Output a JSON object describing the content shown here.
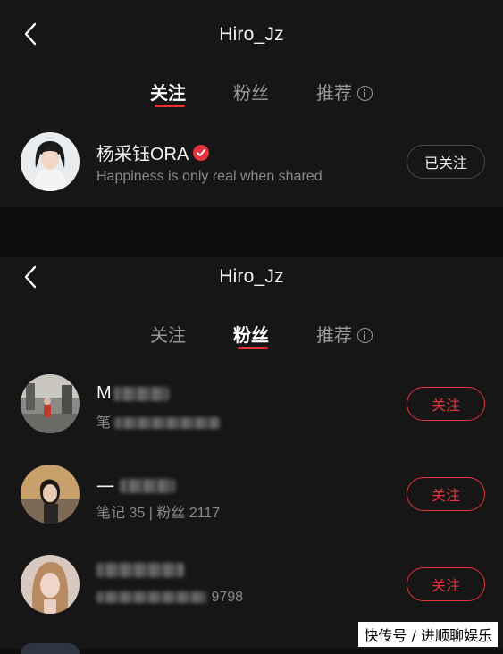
{
  "top": {
    "title": "Hiro_Jz",
    "tabs": [
      {
        "label": "关注",
        "active": true
      },
      {
        "label": "粉丝",
        "active": false
      },
      {
        "label": "推荐",
        "active": false
      }
    ],
    "user": {
      "name": "杨采钰ORA",
      "bio": "Happiness is only real when shared",
      "button": "已关注"
    }
  },
  "bottom": {
    "title": "Hiro_Jz",
    "tabs": [
      {
        "label": "关注",
        "active": false
      },
      {
        "label": "粉丝",
        "active": true
      },
      {
        "label": "推荐",
        "active": false
      }
    ],
    "followers": [
      {
        "name": "M",
        "stats": "笔",
        "button": "关注"
      },
      {
        "name": "一",
        "stats": "笔记 35 | 粉丝 2117",
        "button": "关注"
      },
      {
        "name": "",
        "stats": "9798",
        "button": "关注"
      }
    ]
  },
  "watermark": "快传号 / 进顺聊娱乐",
  "colors": {
    "accent": "#e8333d",
    "background": "#161616"
  }
}
